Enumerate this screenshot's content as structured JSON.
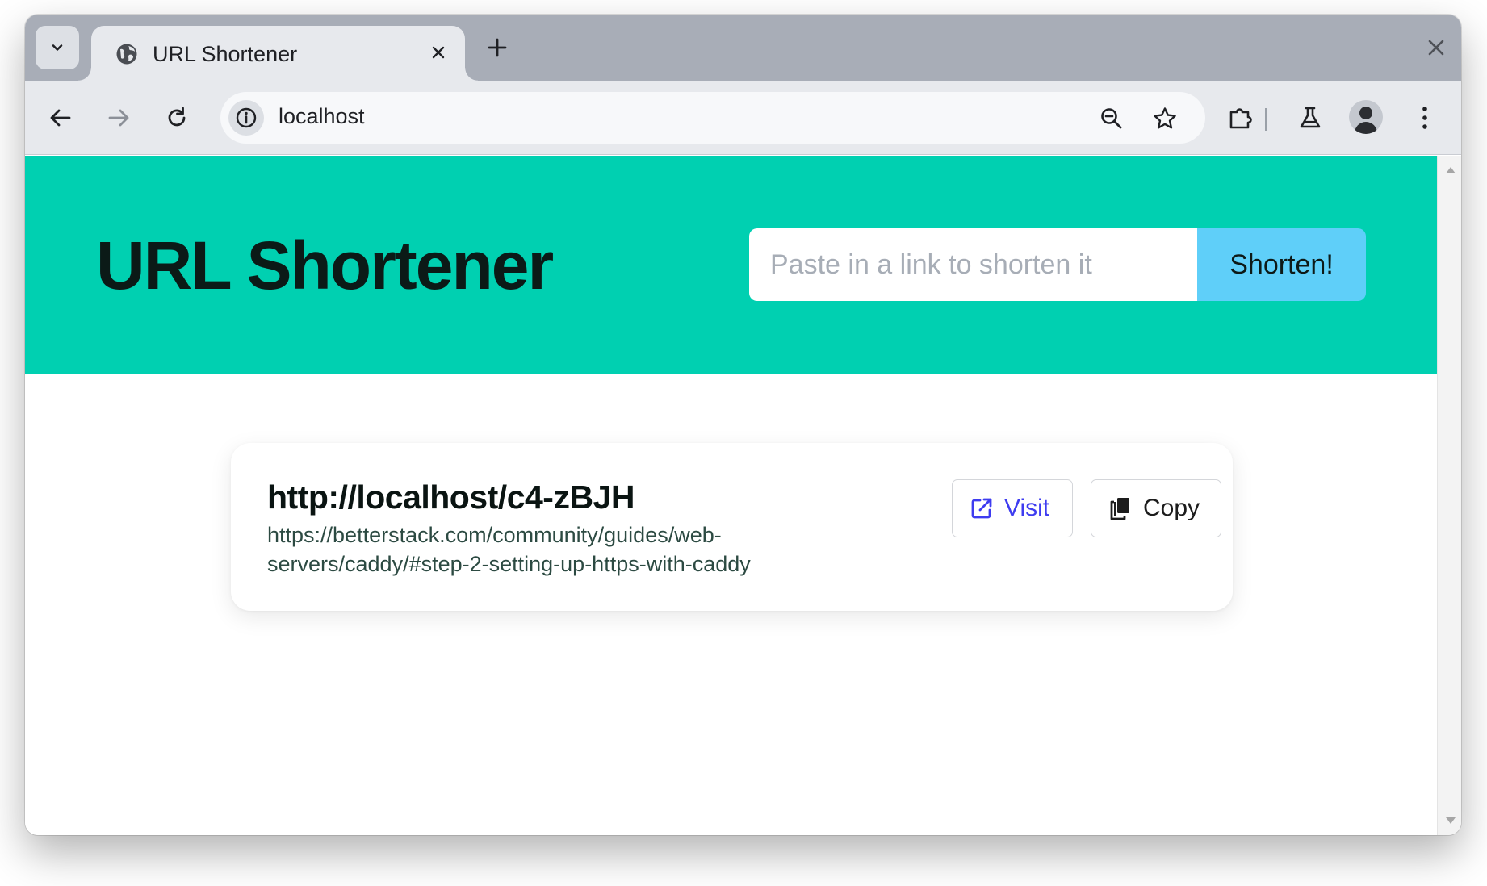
{
  "browser": {
    "tab_title": "URL Shortener",
    "address": "localhost"
  },
  "icons": {
    "tab_search": "chevron-down-icon",
    "favicon": "globe-icon",
    "tab_close": "close-icon",
    "new_tab": "plus-icon",
    "window_close": "close-icon",
    "back": "arrow-left-icon",
    "forward": "arrow-right-icon",
    "reload": "reload-icon",
    "site_info": "info-icon",
    "zoom": "zoom-out-icon",
    "bookmark": "star-icon",
    "extensions": "puzzle-icon",
    "labs": "flask-icon",
    "profile": "avatar-icon",
    "menu": "kebab-menu-icon",
    "visit": "external-link-icon",
    "copy": "copy-icon"
  },
  "app": {
    "title": "URL Shortener",
    "input_placeholder": "Paste in a link to shorten it",
    "input_value": "",
    "submit_label": "Shorten!"
  },
  "result": {
    "short_url": "http://localhost/c4-zBJH",
    "original_url": "https://betterstack.com/community/guides/web-servers/caddy/#step-2-setting-up-https-with-caddy",
    "visit_label": "Visit",
    "copy_label": "Copy"
  },
  "colors": {
    "header_bg": "#00d0b1",
    "button_bg": "#5fcff9",
    "visit_text": "#3e3cf0",
    "link_text": "#2c4a42"
  }
}
